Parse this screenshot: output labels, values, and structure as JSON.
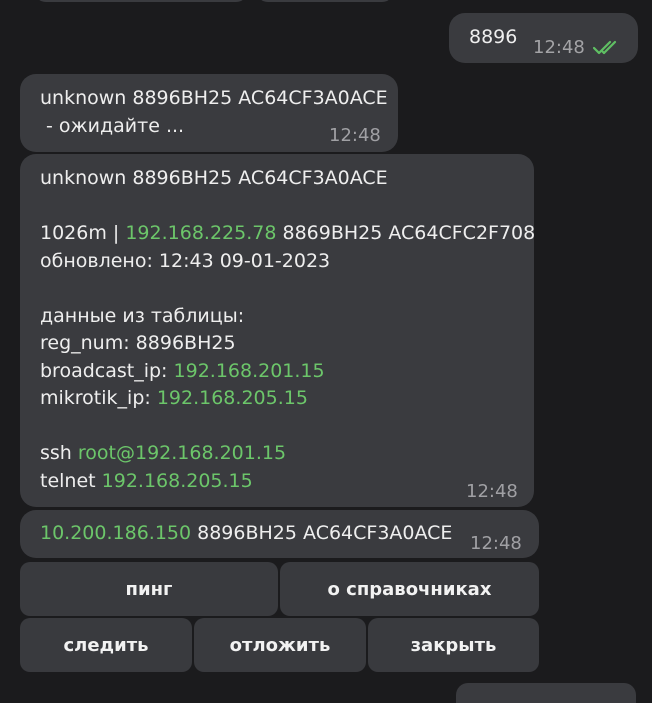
{
  "outgoing": {
    "text": "8896",
    "time": "12:48",
    "status_icon": "double-check-icon"
  },
  "msg1": {
    "lines": [
      "unknown 8896BH25 AC64CF3A0ACE",
      " - ожидайте ..."
    ],
    "time": "12:48"
  },
  "msg2": {
    "line1": "unknown 8896BH25 AC64CF3A0ACE",
    "line2_prefix": "1026m | ",
    "line2_ip": "192.168.225.78",
    "line2_suffix": " 8869BH25 AC64CFC2F708",
    "line3": "обновлено: 12:43 09-01-2023",
    "line4": "данные из таблицы:",
    "line5": "reg_num: 8896BH25",
    "line6_label": "broadcast_ip: ",
    "line6_ip": "192.168.201.15",
    "line7_label": "mikrotik_ip: ",
    "line7_ip": "192.168.205.15",
    "line8_label": "ssh ",
    "line8_link": "root@192.168.201.15",
    "line9_label": "telnet ",
    "line9_ip": "192.168.205.15",
    "time": "12:48"
  },
  "msg3": {
    "ip": "10.200.186.150",
    "suffix": " 8896BH25 AC64CF3A0ACE",
    "time": "12:48"
  },
  "buttons": {
    "ping": "пинг",
    "about": "о справочниках",
    "watch": "следить",
    "postpone": "отложить",
    "close": "закрыть"
  },
  "colors": {
    "bubble": "#3a3b3f",
    "link": "#6cc66a",
    "background": "#1b1b1d"
  }
}
